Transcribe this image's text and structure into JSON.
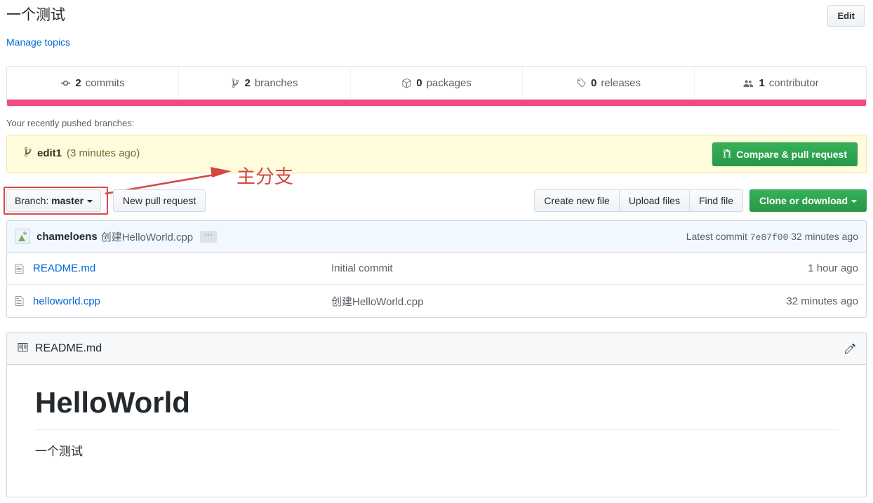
{
  "header": {
    "description": "一个测试",
    "manage_topics_label": "Manage topics",
    "edit_label": "Edit"
  },
  "stats": [
    {
      "icon": "commit-icon",
      "count": "2",
      "label": "commits"
    },
    {
      "icon": "branch-icon",
      "count": "2",
      "label": "branches"
    },
    {
      "icon": "package-icon",
      "count": "0",
      "label": "packages"
    },
    {
      "icon": "tag-icon",
      "count": "0",
      "label": "releases"
    },
    {
      "icon": "contributors-icon",
      "count": "1",
      "label": "contributor"
    }
  ],
  "language_bar": [
    {
      "name": "C++",
      "percent": 100,
      "color": "#f34b7d"
    }
  ],
  "pushed_branches": {
    "label": "Your recently pushed branches:",
    "branch_name": "edit1",
    "branch_age": "(3 minutes ago)",
    "compare_button": "Compare & pull request"
  },
  "toolbar": {
    "branch_prefix": "Branch:",
    "branch_name": "master",
    "new_pull_request": "New pull request",
    "create_new_file": "Create new file",
    "upload_files": "Upload files",
    "find_file": "Find file",
    "clone_or_download": "Clone or download"
  },
  "annotation": {
    "text": "主分支",
    "color": "#d4483f"
  },
  "latest_commit": {
    "author": "chameloens",
    "message": "创建HelloWorld.cpp",
    "ellipsis": "···",
    "prefix": "Latest commit",
    "sha": "7e87f00",
    "age": "32 minutes ago"
  },
  "files": [
    {
      "icon": "file-icon",
      "name": "README.md",
      "message": "Initial commit",
      "age": "1 hour ago"
    },
    {
      "icon": "file-icon",
      "name": "helloworld.cpp",
      "message": "创建HelloWorld.cpp",
      "age": "32 minutes ago"
    }
  ],
  "readme": {
    "icon": "book-icon",
    "title": "README.md",
    "edit_icon": "pencil-icon",
    "heading": "HelloWorld",
    "paragraph": "一个测试"
  }
}
